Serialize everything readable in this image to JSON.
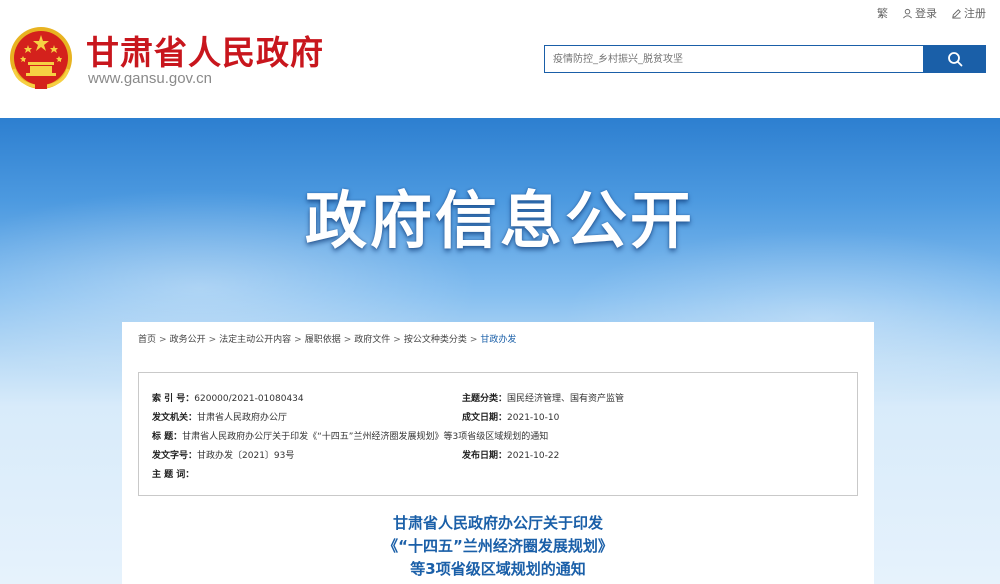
{
  "header": {
    "site_name": "甘肃省人民政府",
    "site_url": "www.gansu.gov.cn",
    "toplinks": {
      "traditional": "繁",
      "login": "登录",
      "register": "注册"
    },
    "search": {
      "placeholder": "疫情防控_乡村振兴_脱贫攻坚"
    }
  },
  "banner": {
    "title": "政府信息公开"
  },
  "breadcrumb": [
    "首页",
    "政务公开",
    "法定主动公开内容",
    "履职依据",
    "政府文件",
    "按公文种类分类",
    "甘政办发"
  ],
  "meta": {
    "index_label": "索  引  号：",
    "index_value": "620000/2021-01080434",
    "topic_label": "主题分类：",
    "topic_value": "国民经济管理、国有资产监管",
    "issuer_label": "发文机关：",
    "issuer_value": "甘肃省人民政府办公厅",
    "created_label": "成文日期：",
    "created_value": "2021-10-10",
    "title_label": "标        题：",
    "title_value": "甘肃省人民政府办公厅关于印发《“十四五”兰州经济圈发展规划》等3项省级区域规划的通知",
    "docno_label": "发文字号：",
    "docno_value": "甘政办发〔2021〕93号",
    "published_label": "发布日期：",
    "published_value": "2021-10-22",
    "keywords_label": "主  题  词：",
    "keywords_value": ""
  },
  "document": {
    "title_line1": "甘肃省人民政府办公厅关于印发",
    "title_line2": "《“十四五”兰州经济圈发展规划》",
    "title_line3": "等3项省级区域规划的通知"
  },
  "colors": {
    "brand_red": "#c8161d",
    "brand_blue": "#1a5fa8",
    "emblem_gold": "#e8b321"
  }
}
